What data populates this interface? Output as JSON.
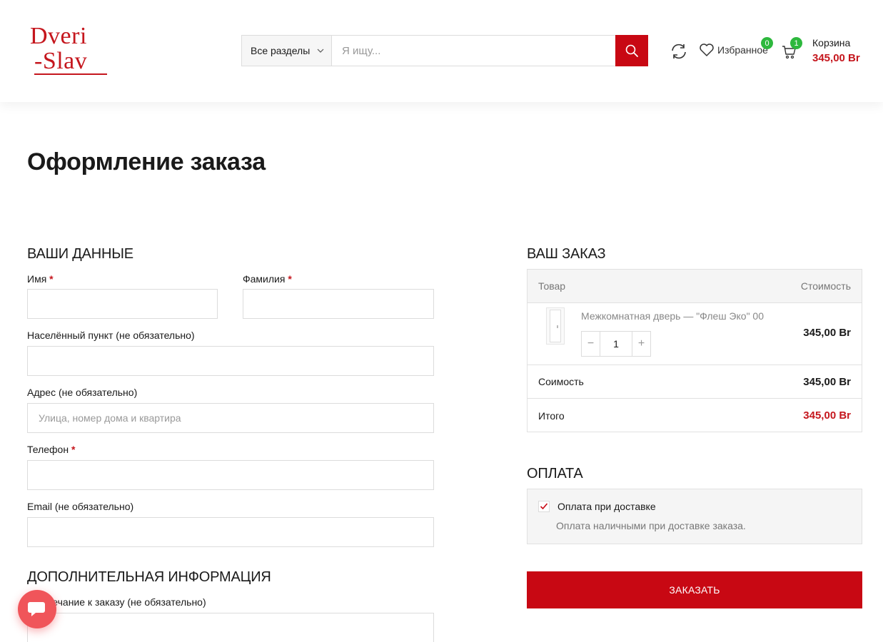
{
  "header": {
    "logo": {
      "line1": "Dveri",
      "line2": "-Slav"
    },
    "search": {
      "category": "Все разделы",
      "placeholder": "Я ищу..."
    },
    "wishlist": {
      "label": "Избранное",
      "count": "0"
    },
    "cart": {
      "label": "Корзина",
      "count": "1",
      "total": "345,00 Br"
    }
  },
  "page": {
    "title": "Оформление заказа"
  },
  "billing": {
    "heading": "ВАШИ ДАННЫЕ",
    "first_name": {
      "label": "Имя",
      "required": "*",
      "value": ""
    },
    "last_name": {
      "label": "Фамилия",
      "required": "*",
      "value": ""
    },
    "city": {
      "label": "Населённый пункт (не обязательно)",
      "value": ""
    },
    "address": {
      "label": "Адрес (не обязательно)",
      "placeholder": "Улица, номер дома и квартира",
      "value": ""
    },
    "phone": {
      "label": "Телефон",
      "required": "*",
      "value": ""
    },
    "email": {
      "label": "Email (не обязательно)",
      "value": ""
    }
  },
  "additional": {
    "heading": "ДОПОЛНИТЕЛЬНАЯ ИНФОРМАЦИЯ",
    "notes_label": "Примечание к заказу (не обязательно)"
  },
  "order": {
    "heading": "ВАШ ЗАКАЗ",
    "col_product": "Товар",
    "col_cost": "Стоимость",
    "items": [
      {
        "name": "Межкомнатная дверь — \"Флеш Эко\" 00",
        "qty": "1",
        "price": "345,00 Br"
      }
    ],
    "subtotal_label": "Соимость",
    "subtotal": "345,00 Br",
    "total_label": "Итого",
    "total": "345,00 Br"
  },
  "payment": {
    "heading": "ОПЛАТА",
    "method_label": "Оплата при доставке",
    "method_checked": true,
    "method_desc": "Оплата наличными при доставке заказа."
  },
  "place_order": {
    "label": "ЗАКАЗАТЬ"
  },
  "colors": {
    "accent": "#c80813",
    "badge": "#2db83d",
    "chat": "#f0555a"
  }
}
